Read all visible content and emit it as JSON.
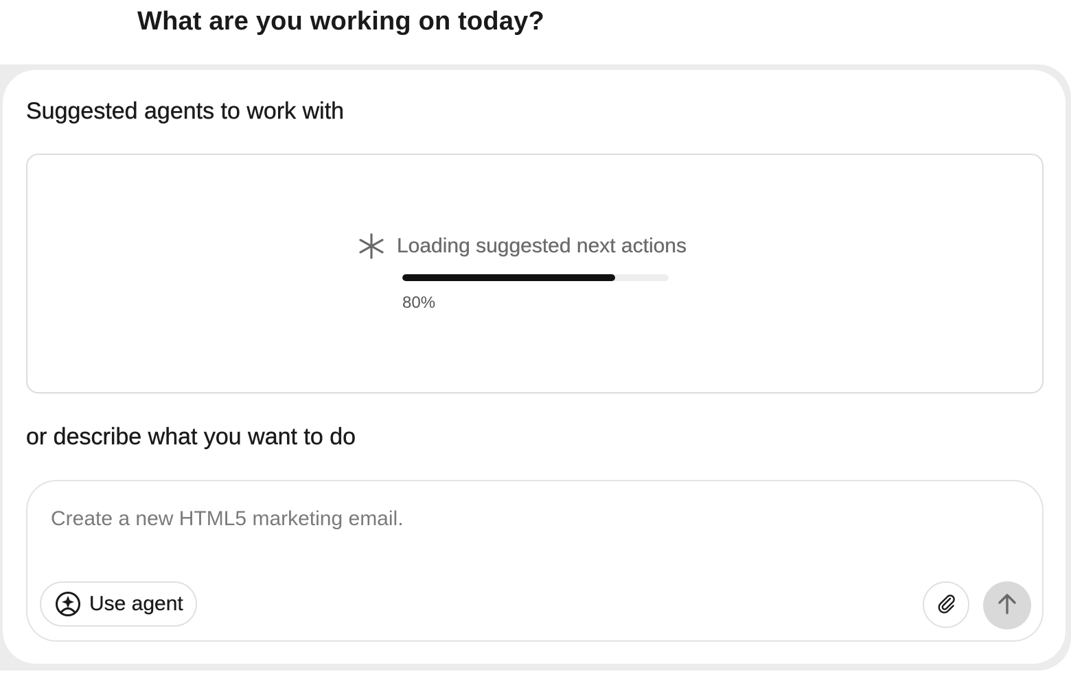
{
  "page": {
    "title": "What are you working on today?"
  },
  "suggestions": {
    "heading": "Suggested agents to work with",
    "loading": {
      "icon": "sparkle-asterisk-icon",
      "text": "Loading suggested next actions",
      "progress_percent": 80,
      "progress_label": "80%"
    }
  },
  "composer": {
    "heading": "or describe what you want to do",
    "placeholder": "Create a new HTML5 marketing email.",
    "value": "",
    "use_agent_label": "Use agent",
    "use_agent_icon": "agent-face-icon",
    "attach_icon": "paperclip-icon",
    "send_icon": "arrow-up-icon"
  },
  "colors": {
    "progress_fill": "#111111",
    "progress_track": "#eeeeee",
    "send_button_bg": "#d9d9d9",
    "panel_bg": "#ececec"
  }
}
